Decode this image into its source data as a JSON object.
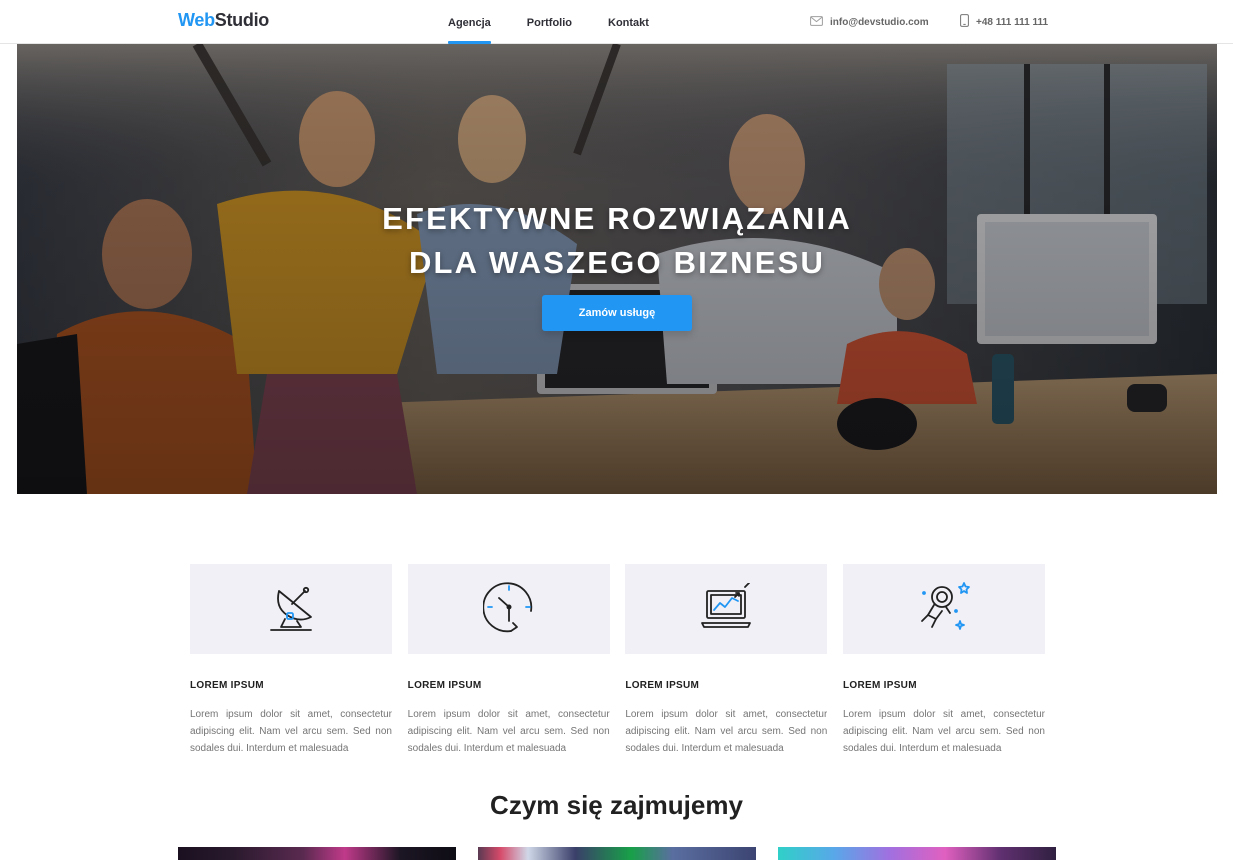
{
  "header": {
    "logo_part1": "Web",
    "logo_part2": "Studio",
    "nav": [
      {
        "label": "Agencja",
        "active": true
      },
      {
        "label": "Portfolio",
        "active": false
      },
      {
        "label": "Kontakt",
        "active": false
      }
    ],
    "email": "info@devstudio.com",
    "phone": "+48 111 111 111"
  },
  "hero": {
    "title_line1": "Efektywne rozwiązania",
    "title_line2": "dla waszego biznesu",
    "button_label": "Zamów usługę"
  },
  "features": [
    {
      "icon": "satellite-dish-icon",
      "title": "LOREM IPSUM",
      "text": "Lorem ipsum dolor sit amet, consectetur adipiscing elit. Nam vel arcu sem. Sed non sodales dui. Interdum et malesuada"
    },
    {
      "icon": "clock-icon",
      "title": "LOREM IPSUM",
      "text": "Lorem ipsum dolor sit amet, consectetur adipiscing elit. Nam vel arcu sem. Sed non sodales dui. Interdum et malesuada"
    },
    {
      "icon": "laptop-chart-icon",
      "title": "LOREM IPSUM",
      "text": "Lorem ipsum dolor sit amet, consectetur adipiscing elit. Nam vel arcu sem. Sed non sodales dui. Interdum et malesuada"
    },
    {
      "icon": "astronaut-icon",
      "title": "LOREM IPSUM",
      "text": "Lorem ipsum dolor sit amet, consectetur adipiscing elit. Nam vel arcu sem. Sed non sodales dui. Interdum et malesuada"
    }
  ],
  "section": {
    "title": "Czym się zajmujemy"
  },
  "colors": {
    "accent": "#2196f3",
    "text_dark": "#212121",
    "feature_bg": "#f1f0f7"
  }
}
